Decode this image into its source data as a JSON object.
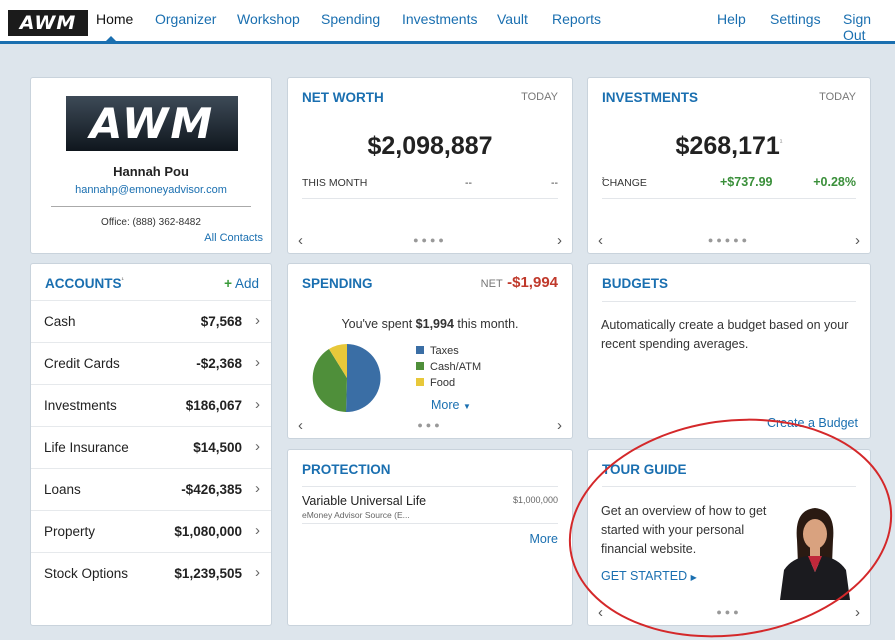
{
  "nav": {
    "logo": "AWM",
    "items": [
      "Home",
      "Organizer",
      "Workshop",
      "Spending",
      "Investments",
      "Vault",
      "Reports"
    ],
    "right_items": [
      "Help",
      "Settings",
      "Sign Out"
    ]
  },
  "profile": {
    "logo": "AWM",
    "name": "Hannah Pou",
    "email": "hannahp@emoneyadvisor.com",
    "office": "Office: (888) 362-8482",
    "all_contacts": "All Contacts"
  },
  "net_worth": {
    "title": "NET WORTH",
    "today": "TODAY",
    "value": "$2,098,887",
    "period": "THIS MONTH",
    "change": "--",
    "change_pct": "--"
  },
  "investments": {
    "title": "INVESTMENTS",
    "today": "TODAY",
    "value": "$268,171",
    "value_mark": "¹",
    "change_label": "CHANGE",
    "change_mark": "²",
    "change": "+$737.99",
    "change_pct": "+0.28%"
  },
  "accounts": {
    "title": "ACCOUNTS",
    "title_mark": "¹",
    "add_icon": "+",
    "add_label": "Add",
    "rows": [
      {
        "label": "Cash",
        "value": "$7,568"
      },
      {
        "label": "Credit Cards",
        "value": "-$2,368"
      },
      {
        "label": "Investments",
        "value": "$186,067"
      },
      {
        "label": "Life Insurance",
        "value": "$14,500"
      },
      {
        "label": "Loans",
        "value": "-$426,385"
      },
      {
        "label": "Property",
        "value": "$1,080,000"
      },
      {
        "label": "Stock Options",
        "value": "$1,239,505"
      }
    ]
  },
  "spending": {
    "title": "SPENDING",
    "net_label": "NET",
    "net_value": "-$1,994",
    "summary_pre": "You've spent ",
    "summary_amount": "$1,994",
    "summary_post": " this month.",
    "legend": [
      {
        "label": "Taxes",
        "color": "#3a6ea5"
      },
      {
        "label": "Cash/ATM",
        "color": "#4f8f3a"
      },
      {
        "label": "Food",
        "color": "#e8c83a"
      }
    ],
    "more": "More"
  },
  "budgets": {
    "title": "BUDGETS",
    "text": "Automatically create a budget based on your recent spending averages.",
    "link": "Create a Budget"
  },
  "protection": {
    "title": "PROTECTION",
    "policy_name": "Variable Universal Life",
    "policy_sub": "eMoney Advisor Source (E...",
    "policy_value": "$1,000,000",
    "more": "More"
  },
  "tour": {
    "title": "TOUR GUIDE",
    "text": "Get an overview of how to get started with your personal financial website.",
    "cta": "GET STARTED"
  },
  "colors": {
    "accent": "#1a6fb0",
    "positive": "#3a8f3a",
    "negative": "#c0392b",
    "highlight": "#d4282a"
  }
}
